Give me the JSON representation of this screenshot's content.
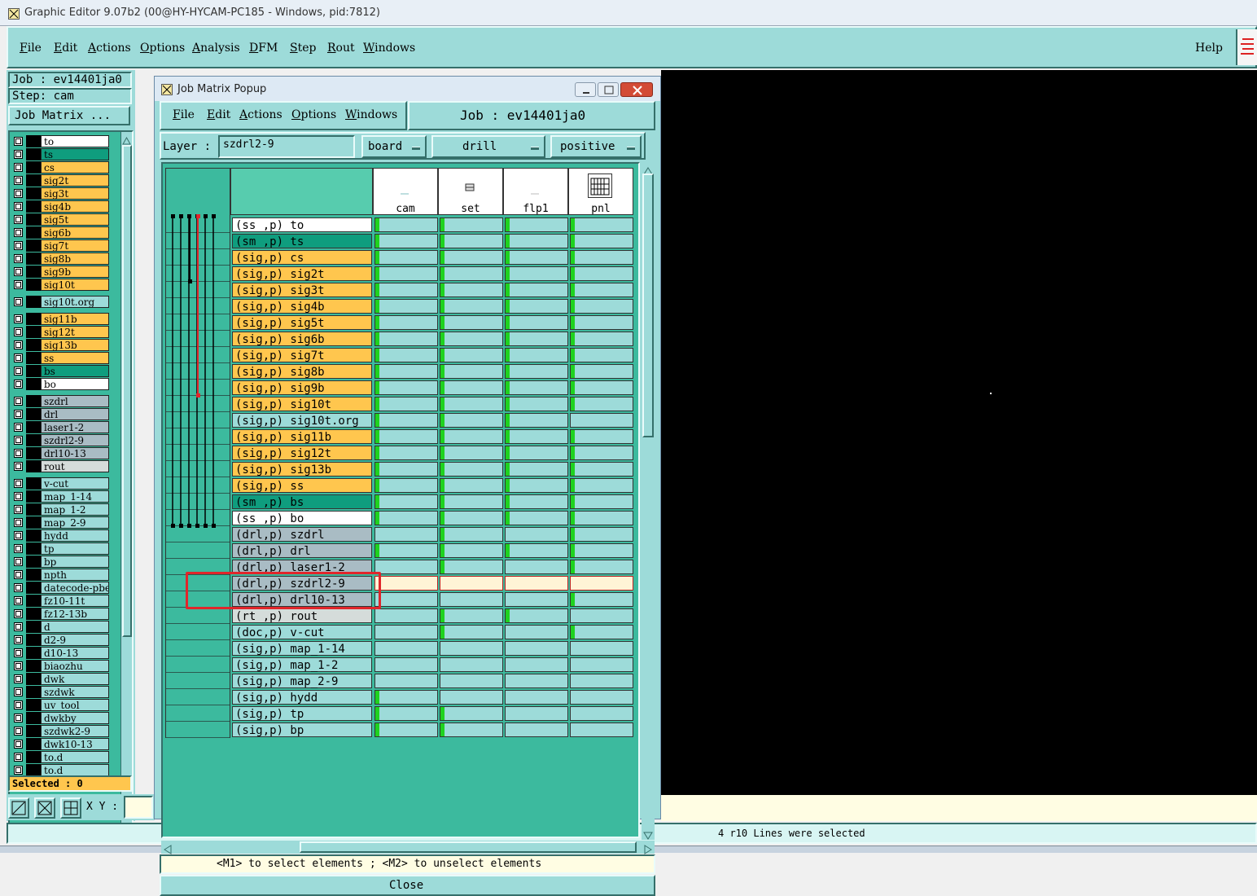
{
  "app": {
    "title": "Graphic Editor 9.07b2 (00@HY-HYCAM-PC185 - Windows, pid:7812)",
    "menu": [
      "File",
      "Edit",
      "Actions",
      "Options",
      "Analysis",
      "DFM",
      "Step",
      "Rout",
      "Windows"
    ],
    "help": "Help"
  },
  "left_panel": {
    "job": "Job : ev14401ja0",
    "step": "Step: cam",
    "job_matrix_button": "Job Matrix ...",
    "selected": "Selected : 0",
    "xy_label": "X Y :",
    "layers": [
      {
        "name": "to",
        "color": "#ffffff"
      },
      {
        "name": "ts",
        "color": "#0f9d7e"
      },
      {
        "name": "cs",
        "color": "#ffc64e"
      },
      {
        "name": "sig2t",
        "color": "#ffc64e"
      },
      {
        "name": "sig3t",
        "color": "#ffc64e"
      },
      {
        "name": "sig4b",
        "color": "#ffc64e"
      },
      {
        "name": "sig5t",
        "color": "#ffc64e"
      },
      {
        "name": "sig6b",
        "color": "#ffc64e"
      },
      {
        "name": "sig7t",
        "color": "#ffc64e"
      },
      {
        "name": "sig8b",
        "color": "#ffc64e"
      },
      {
        "name": "sig9b",
        "color": "#ffc64e"
      },
      {
        "name": "sig10t",
        "color": "#ffc64e"
      },
      {
        "name": "sig10t.org",
        "color": "#9ddbd9"
      },
      {
        "name": "sig11b",
        "color": "#ffc64e"
      },
      {
        "name": "sig12t",
        "color": "#ffc64e"
      },
      {
        "name": "sig13b",
        "color": "#ffc64e"
      },
      {
        "name": "ss",
        "color": "#ffc64e"
      },
      {
        "name": "bs",
        "color": "#0f9d7e"
      },
      {
        "name": "bo",
        "color": "#ffffff"
      },
      {
        "name": "szdrl",
        "color": "#a9bcc4"
      },
      {
        "name": "drl",
        "color": "#a9bcc4"
      },
      {
        "name": "laser1-2",
        "color": "#a9bcc4"
      },
      {
        "name": "szdrl2-9",
        "color": "#a9bcc4"
      },
      {
        "name": "drl10-13",
        "color": "#a9bcc4"
      },
      {
        "name": "rout",
        "color": "#d5dcda"
      },
      {
        "name": "v-cut",
        "color": "#9ddbd9"
      },
      {
        "name": "map_1-14",
        "color": "#9ddbd9"
      },
      {
        "name": "map_1-2",
        "color": "#9ddbd9"
      },
      {
        "name": "map_2-9",
        "color": "#9ddbd9"
      },
      {
        "name": "hydd",
        "color": "#9ddbd9"
      },
      {
        "name": "tp",
        "color": "#9ddbd9"
      },
      {
        "name": "bp",
        "color": "#9ddbd9"
      },
      {
        "name": "npth",
        "color": "#9ddbd9"
      },
      {
        "name": "datecode-pbe",
        "color": "#9ddbd9"
      },
      {
        "name": "fz10-11t",
        "color": "#9ddbd9"
      },
      {
        "name": "fz12-13b",
        "color": "#9ddbd9"
      },
      {
        "name": "d",
        "color": "#9ddbd9"
      },
      {
        "name": "d2-9",
        "color": "#9ddbd9"
      },
      {
        "name": "d10-13",
        "color": "#9ddbd9"
      },
      {
        "name": "biaozhu",
        "color": "#9ddbd9"
      },
      {
        "name": "dwk",
        "color": "#9ddbd9"
      },
      {
        "name": "szdwk",
        "color": "#9ddbd9"
      },
      {
        "name": "uv_tool",
        "color": "#9ddbd9"
      },
      {
        "name": "dwkby",
        "color": "#9ddbd9"
      },
      {
        "name": "szdwk2-9",
        "color": "#9ddbd9"
      },
      {
        "name": "dwk10-13",
        "color": "#9ddbd9"
      },
      {
        "name": "to.d",
        "color": "#9ddbd9"
      },
      {
        "name": "to.d",
        "color": "#9ddbd9"
      }
    ]
  },
  "popup": {
    "title": "Job Matrix Popup",
    "menu": [
      "File",
      "Edit",
      "Actions",
      "Options",
      "Windows"
    ],
    "job": "Job : ev14401ja0",
    "layer_label": "Layer :",
    "layer_value": "szdrl2-9",
    "context": "board",
    "type": "drill",
    "polarity": "positive",
    "steps": [
      "cam",
      "set",
      "flp1",
      "pnl"
    ],
    "rows": [
      {
        "label": "(ss ,p) to",
        "color": "#ffffff",
        "g": [
          1,
          1,
          1,
          1
        ]
      },
      {
        "label": "(sm ,p) ts",
        "color": "#0f9d7e",
        "g": [
          1,
          1,
          1,
          1
        ]
      },
      {
        "label": "(sig,p) cs",
        "color": "#ffc64e",
        "g": [
          1,
          1,
          1,
          1
        ]
      },
      {
        "label": "(sig,p) sig2t",
        "color": "#ffc64e",
        "g": [
          1,
          1,
          1,
          1
        ]
      },
      {
        "label": "(sig,p) sig3t",
        "color": "#ffc64e",
        "g": [
          1,
          1,
          1,
          1
        ]
      },
      {
        "label": "(sig,p) sig4b",
        "color": "#ffc64e",
        "g": [
          1,
          1,
          1,
          1
        ]
      },
      {
        "label": "(sig,p) sig5t",
        "color": "#ffc64e",
        "g": [
          1,
          1,
          1,
          1
        ]
      },
      {
        "label": "(sig,p) sig6b",
        "color": "#ffc64e",
        "g": [
          1,
          1,
          1,
          1
        ]
      },
      {
        "label": "(sig,p) sig7t",
        "color": "#ffc64e",
        "g": [
          1,
          1,
          1,
          1
        ]
      },
      {
        "label": "(sig,p) sig8b",
        "color": "#ffc64e",
        "g": [
          1,
          1,
          1,
          1
        ]
      },
      {
        "label": "(sig,p) sig9b",
        "color": "#ffc64e",
        "g": [
          1,
          1,
          1,
          1
        ]
      },
      {
        "label": "(sig,p) sig10t",
        "color": "#ffc64e",
        "g": [
          1,
          1,
          1,
          1
        ]
      },
      {
        "label": "(sig,p) sig10t.org",
        "color": "#9ddbd9",
        "g": [
          1,
          1,
          1,
          0
        ]
      },
      {
        "label": "(sig,p) sig11b",
        "color": "#ffc64e",
        "g": [
          1,
          1,
          1,
          1
        ]
      },
      {
        "label": "(sig,p) sig12t",
        "color": "#ffc64e",
        "g": [
          1,
          1,
          1,
          1
        ]
      },
      {
        "label": "(sig,p) sig13b",
        "color": "#ffc64e",
        "g": [
          1,
          1,
          1,
          1
        ]
      },
      {
        "label": "(sig,p) ss",
        "color": "#ffc64e",
        "g": [
          1,
          1,
          1,
          1
        ]
      },
      {
        "label": "(sm ,p) bs",
        "color": "#0f9d7e",
        "g": [
          1,
          1,
          1,
          1
        ]
      },
      {
        "label": "(ss ,p) bo",
        "color": "#ffffff",
        "g": [
          1,
          1,
          1,
          1
        ]
      },
      {
        "label": "(drl,p) szdrl",
        "color": "#a9bcc4",
        "g": [
          0,
          1,
          0,
          1
        ]
      },
      {
        "label": "(drl,p) drl",
        "color": "#a9bcc4",
        "g": [
          1,
          1,
          1,
          1
        ]
      },
      {
        "label": "(drl,p) laser1-2",
        "color": "#a9bcc4",
        "g": [
          0,
          1,
          0,
          1
        ]
      },
      {
        "label": "(drl,p) szdrl2-9",
        "color": "#a9bcc4",
        "g": [
          0,
          0,
          0,
          0
        ],
        "selected": true
      },
      {
        "label": "(drl,p) drl10-13",
        "color": "#a9bcc4",
        "g": [
          0,
          0,
          0,
          1
        ]
      },
      {
        "label": "(rt ,p) rout",
        "color": "#d5dcda",
        "g": [
          0,
          1,
          1,
          0
        ]
      },
      {
        "label": "(doc,p) v-cut",
        "color": "#9ddbd9",
        "g": [
          0,
          1,
          0,
          1
        ]
      },
      {
        "label": "(sig,p) map_1-14",
        "color": "#9ddbd9",
        "g": [
          0,
          0,
          0,
          0
        ]
      },
      {
        "label": "(sig,p) map_1-2",
        "color": "#9ddbd9",
        "g": [
          0,
          0,
          0,
          0
        ]
      },
      {
        "label": "(sig,p) map_2-9",
        "color": "#9ddbd9",
        "g": [
          0,
          0,
          0,
          0
        ]
      },
      {
        "label": "(sig,p) hydd",
        "color": "#9ddbd9",
        "g": [
          1,
          0,
          0,
          0
        ]
      },
      {
        "label": "(sig,p) tp",
        "color": "#9ddbd9",
        "g": [
          1,
          1,
          0,
          0
        ]
      },
      {
        "label": "(sig,p) bp",
        "color": "#9ddbd9",
        "g": [
          1,
          1,
          0,
          0
        ]
      }
    ],
    "hint": "<M1> to select elements ; <M2> to unselect elements",
    "close": "Close"
  },
  "status": "4 r10 Lines were selected"
}
